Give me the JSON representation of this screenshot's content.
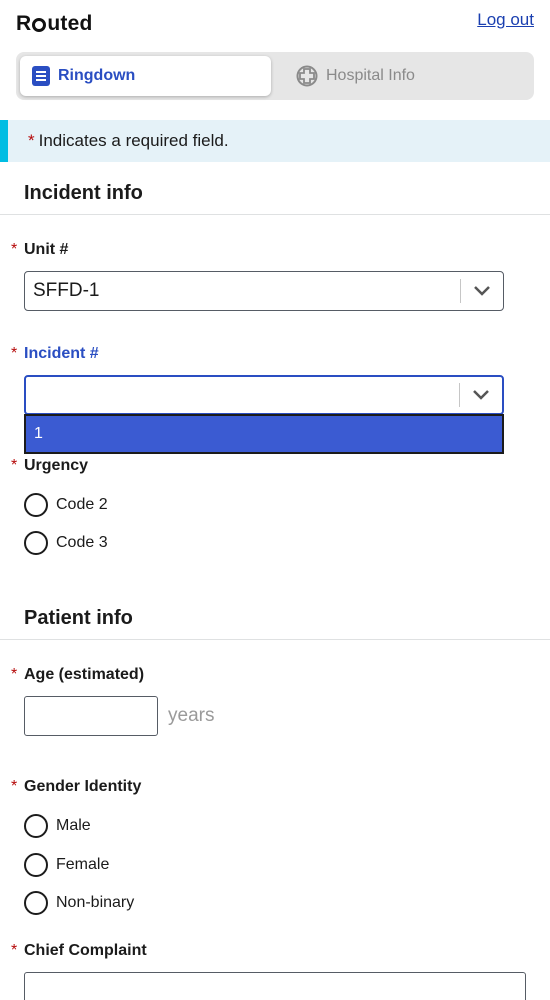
{
  "header": {
    "logo_text_pre": "R",
    "logo_text_post": "uted",
    "logout_label": "Log out"
  },
  "tabs": [
    {
      "label": "Ringdown",
      "icon": "clipboard-icon",
      "active": true
    },
    {
      "label": "Hospital Info",
      "icon": "hospital-plus-icon",
      "active": false
    }
  ],
  "alert": {
    "asterisk": "*",
    "text": "Indicates a required field."
  },
  "incident_section": {
    "title": "Incident info",
    "unit": {
      "label": "Unit #",
      "value": "SFFD-1"
    },
    "incident": {
      "label": "Incident #",
      "value": "",
      "options": [
        "1"
      ]
    },
    "urgency": {
      "label": "Urgency",
      "options": [
        "Code 2",
        "Code 3"
      ]
    }
  },
  "patient_section": {
    "title": "Patient info",
    "age": {
      "label": "Age (estimated)",
      "suffix": "years",
      "value": ""
    },
    "gender": {
      "label": "Gender Identity",
      "options": [
        "Male",
        "Female",
        "Non-binary"
      ]
    },
    "complaint": {
      "label": "Chief Complaint",
      "value": ""
    }
  },
  "colors": {
    "accent": "#2a4ec2",
    "menu_highlight": "#3b5bd2",
    "required": "#b50909",
    "alert_bar": "#00bde3",
    "alert_bg": "#e5f2f8"
  }
}
